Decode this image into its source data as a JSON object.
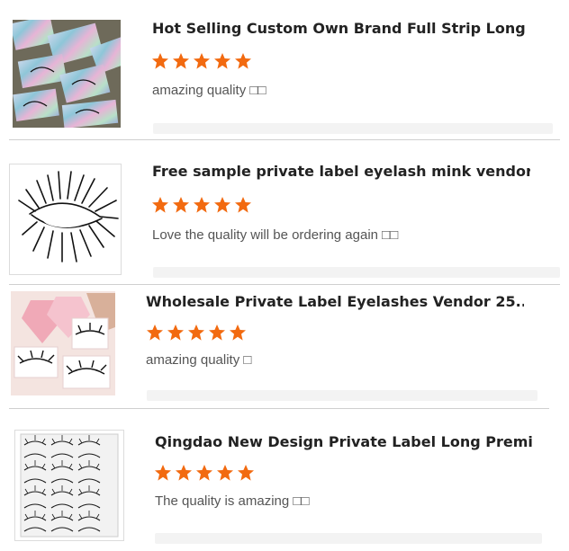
{
  "reviews": [
    {
      "title": "Hot Selling Custom Own Brand Full Strip Long ...",
      "rating": 5,
      "comment": "amazing quality □□",
      "thumb_icon": "holographic-lash-boxes"
    },
    {
      "title": "Free sample private label eyelash mink vendor,...",
      "rating": 5,
      "comment": "Love the quality will be  ordering again □□",
      "thumb_icon": "mink-eyelash-strip"
    },
    {
      "title": "Wholesale Private Label Eyelashes Vendor 25...",
      "rating": 5,
      "comment": "amazing quality □",
      "thumb_icon": "diamond-lash-boxes"
    },
    {
      "title": "Qingdao New Design Private Label Long Premi...",
      "rating": 5,
      "comment": "The quality is amazing □□",
      "thumb_icon": "lash-tray-grid"
    }
  ],
  "colors": {
    "star": "#f26a10",
    "title": "#222222",
    "comment": "#555555"
  }
}
